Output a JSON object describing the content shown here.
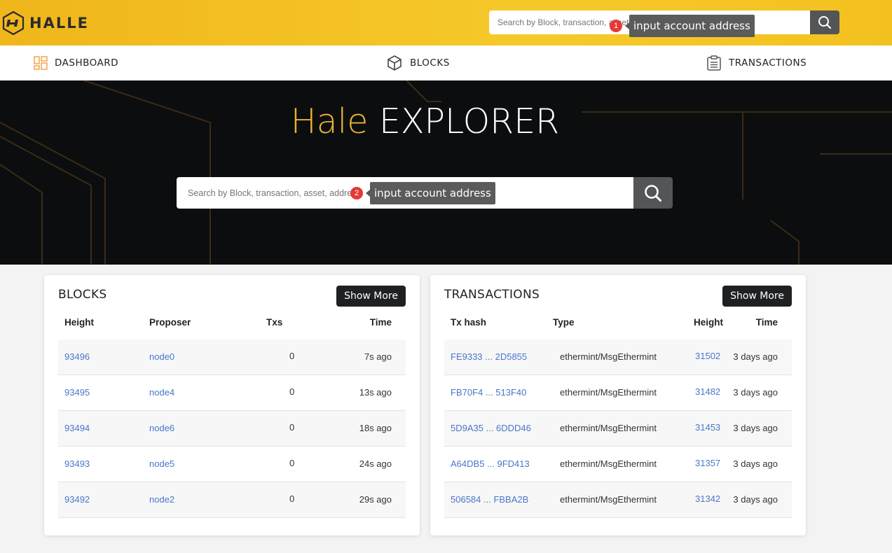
{
  "header": {
    "logo_text": "HALLE",
    "search_placeholder": "Search by Block, transaction, asset, address"
  },
  "nav": {
    "items": [
      {
        "label": "DASHBOARD",
        "icon": "dashboard-icon"
      },
      {
        "label": "BLOCKS",
        "icon": "cube-icon"
      },
      {
        "label": "TRANSACTIONS",
        "icon": "clipboard-list-icon"
      }
    ]
  },
  "hero": {
    "title_accent": "Hale",
    "title_rest": " EXPLORER",
    "search_placeholder": "Search by Block, transaction, asset, address"
  },
  "annotations": [
    {
      "number": "1",
      "text": "input account address"
    },
    {
      "number": "2",
      "text": "input account address"
    }
  ],
  "blocks": {
    "title": "BLOCKS",
    "show_more": "Show More",
    "columns": [
      "Height",
      "Proposer",
      "Txs",
      "Time"
    ],
    "rows": [
      {
        "height": "93496",
        "proposer": "node0",
        "txs": "0",
        "time": "7s ago"
      },
      {
        "height": "93495",
        "proposer": "node4",
        "txs": "0",
        "time": "13s ago"
      },
      {
        "height": "93494",
        "proposer": "node6",
        "txs": "0",
        "time": "18s ago"
      },
      {
        "height": "93493",
        "proposer": "node5",
        "txs": "0",
        "time": "24s ago"
      },
      {
        "height": "93492",
        "proposer": "node2",
        "txs": "0",
        "time": "29s ago"
      }
    ]
  },
  "transactions": {
    "title": "TRANSACTIONS",
    "show_more": "Show More",
    "columns": [
      "Tx hash",
      "Type",
      "Height",
      "Time"
    ],
    "rows": [
      {
        "hash": "FE9333 ... 2D5855",
        "type": "ethermint/MsgEthermint",
        "height": "31502",
        "time": "3 days ago"
      },
      {
        "hash": "FB70F4 ... 513F40",
        "type": "ethermint/MsgEthermint",
        "height": "31482",
        "time": "3 days ago"
      },
      {
        "hash": "5D9A35 ... 6DDD46",
        "type": "ethermint/MsgEthermint",
        "height": "31453",
        "time": "3 days ago"
      },
      {
        "hash": "A64DB5 ... 9FD413",
        "type": "ethermint/MsgEthermint",
        "height": "31357",
        "time": "3 days ago"
      },
      {
        "hash": "506584 ... FBBA2B",
        "type": "ethermint/MsgEthermint",
        "height": "31342",
        "time": "3 days ago"
      }
    ]
  },
  "colors": {
    "brand_yellow": "#f6c92a",
    "accent_gold": "#e9b330",
    "link_blue": "#4a76c9",
    "dark_button": "#1f2022",
    "annotation_red": "#e53935"
  }
}
